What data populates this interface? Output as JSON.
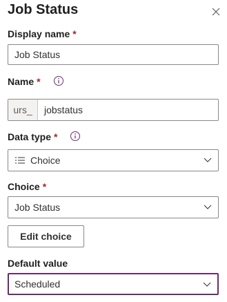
{
  "panel": {
    "title": "Job Status",
    "close_icon": "close-icon"
  },
  "display_name": {
    "label": "Display name",
    "required_mark": "*",
    "value": "Job Status"
  },
  "name": {
    "label": "Name",
    "required_mark": "*",
    "info_icon": "info-icon",
    "prefix": "urs_",
    "value": "jobstatus"
  },
  "data_type": {
    "label": "Data type",
    "required_mark": "*",
    "info_icon": "info-icon",
    "selected_icon": "list-icon",
    "selected": "Choice"
  },
  "choice": {
    "label": "Choice",
    "required_mark": "*",
    "selected": "Job Status",
    "edit_button_label": "Edit choice"
  },
  "default_value": {
    "label": "Default value",
    "selected": "Scheduled"
  },
  "colors": {
    "required": "#a4262c",
    "focus_border": "#6b2c6e",
    "info_icon": "#6b2c6e"
  }
}
